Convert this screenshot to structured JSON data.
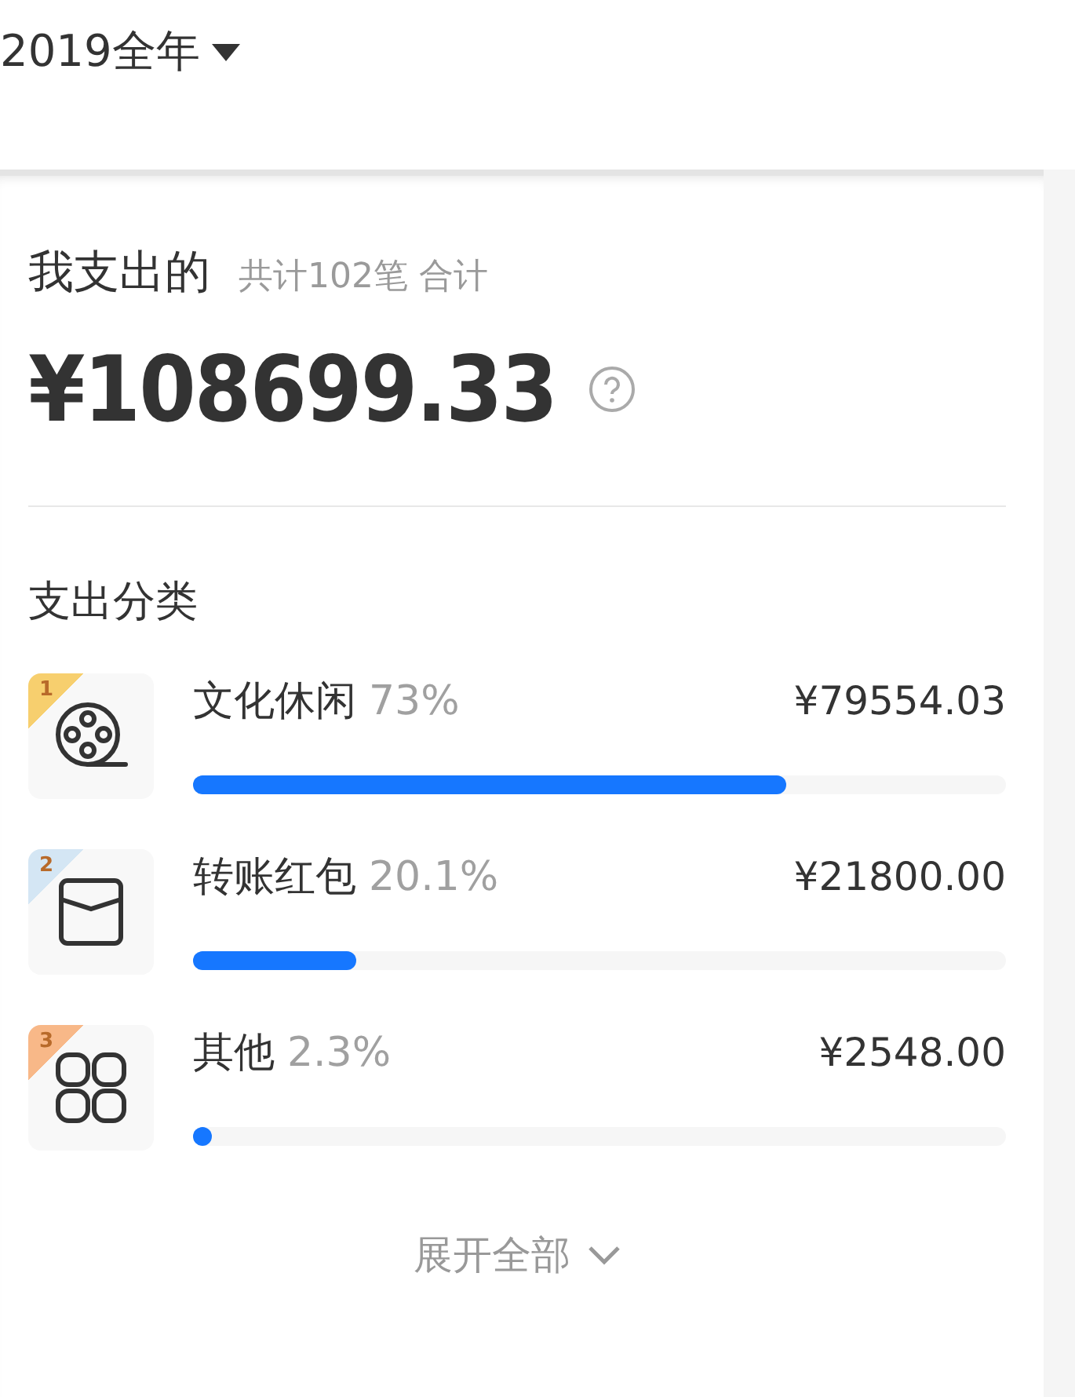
{
  "period_selector": {
    "label": "2019全年"
  },
  "summary": {
    "title": "我支出的",
    "subtitle": "共计102笔 合计",
    "total": "¥108699.33"
  },
  "categories_section": {
    "title": "支出分类",
    "categories": [
      {
        "rank": "1",
        "color": "#f7cf6e",
        "kind": "film",
        "name": "文化休闲",
        "percent": "73%",
        "amount": "¥79554.03",
        "level": 0.73
      },
      {
        "rank": "2",
        "color": "#d4e6f4",
        "kind": "envelope",
        "name": "转账红包",
        "percent": "20.1%",
        "amount": "¥21800.00",
        "level": 0.201
      },
      {
        "rank": "3",
        "color": "#f8b888",
        "kind": "grid",
        "name": "其他",
        "percent": "2.3%",
        "amount": "¥2548.00",
        "level": 0.023
      }
    ],
    "expand_link": "展开全部"
  }
}
